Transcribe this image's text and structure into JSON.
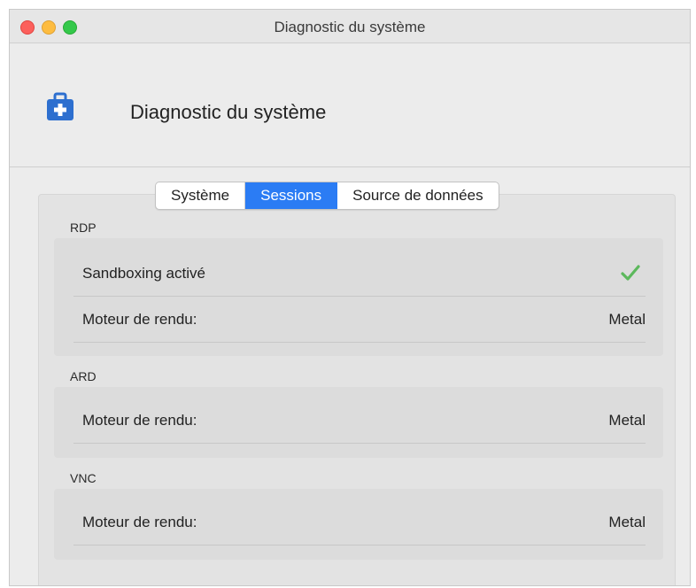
{
  "window": {
    "title": "Diagnostic du système"
  },
  "header": {
    "title": "Diagnostic du système",
    "icon": "medical-kit-icon"
  },
  "tabs": [
    {
      "label": "Système",
      "active": false
    },
    {
      "label": "Sessions",
      "active": true
    },
    {
      "label": "Source de données",
      "active": false
    }
  ],
  "sections": {
    "rdp": {
      "label": "RDP",
      "rows": [
        {
          "label": "Sandboxing activé",
          "value": "",
          "icon": "checkmark-icon"
        },
        {
          "label": "Moteur de rendu:",
          "value": "Metal"
        }
      ]
    },
    "ard": {
      "label": "ARD",
      "rows": [
        {
          "label": "Moteur de rendu:",
          "value": "Metal"
        }
      ]
    },
    "vnc": {
      "label": "VNC",
      "rows": [
        {
          "label": "Moteur de rendu:",
          "value": "Metal"
        }
      ]
    }
  },
  "colors": {
    "accent": "#2b7cf4",
    "check": "#5cb85c",
    "icon": "#2d6fcf",
    "close": "#fc605c",
    "minimize": "#fdbc40",
    "maximize": "#34c84a"
  }
}
